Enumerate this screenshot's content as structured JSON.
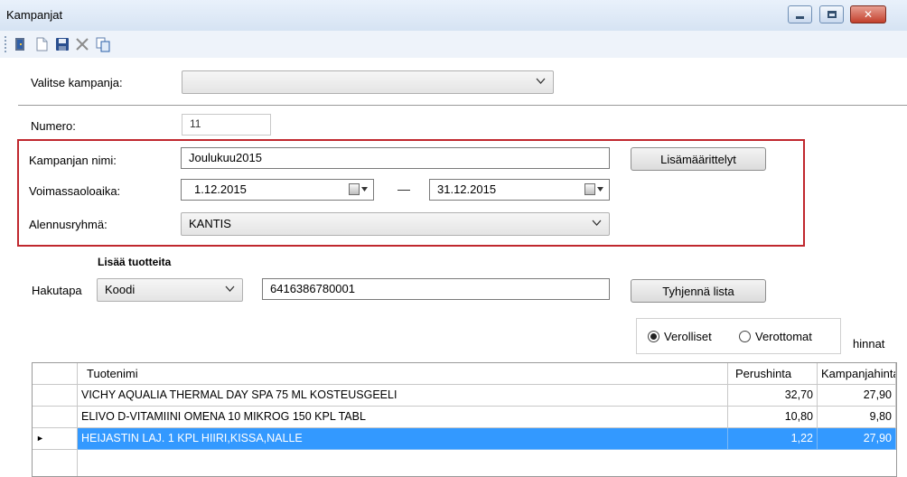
{
  "window": {
    "title": "Kampanjat",
    "close_glyph": "✕"
  },
  "toolbar": {
    "icons": [
      "exit-door-icon",
      "new-document-icon",
      "save-disk-icon",
      "delete-x-icon",
      "copy-icon"
    ]
  },
  "form": {
    "valitse_label": "Valitse kampanja:",
    "valitse_value": "",
    "numero_label": "Numero:",
    "numero_value": "11",
    "nimi_label": "Kampanjan nimi:",
    "nimi_value": "Joulukuu2015",
    "lisamaarittelyt_button": "Lisämäärittelyt",
    "voimassa_label": "Voimassaoloaika:",
    "date_start": "1.12.2015",
    "date_end": "31.12.2015",
    "alennus_label": "Alennusryhmä:",
    "alennus_value": "KANTIS"
  },
  "search": {
    "section_title": "Lisää tuotteita",
    "hakutapa_label": "Hakutapa",
    "hakutapa_value": "Koodi",
    "code_value": "6416386780001",
    "clear_button": "Tyhjennä lista"
  },
  "pricing": {
    "option_verolliset": "Verolliset",
    "option_verottomat": "Verottomat",
    "selected": "Verolliset",
    "suffix": "hinnat"
  },
  "grid": {
    "columns": [
      "Tuotenimi",
      "Perushinta",
      "Kampanjahinta"
    ],
    "rows": [
      {
        "name": "VICHY AQUALIA THERMAL DAY SPA 75 ML KOSTEUSGEELI",
        "base": "32,70",
        "campaign": "27,90",
        "selected": false
      },
      {
        "name": "ELIVO D-VITAMIINI OMENA 10 MIKROG 150 KPL TABL",
        "base": "10,80",
        "campaign": "9,80",
        "selected": false
      },
      {
        "name": "HEIJASTIN LAJ. 1 KPL HIIRI,KISSA,NALLE",
        "base": "1,22",
        "campaign": "27,90",
        "selected": true
      }
    ],
    "row_indicator": "►"
  },
  "colors": {
    "selection": "#3399ff",
    "highlight_border": "#c0282e",
    "titlebar": "#d6e3f3"
  }
}
